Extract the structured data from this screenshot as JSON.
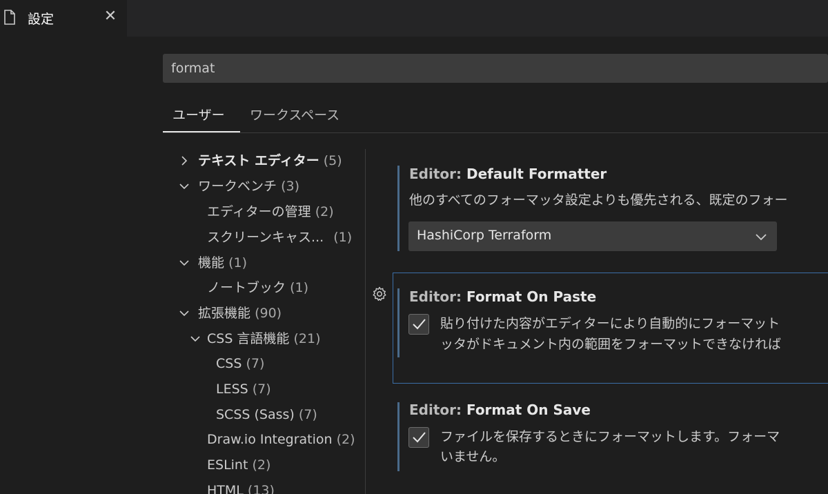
{
  "tab": {
    "title": "設定",
    "close": "✕"
  },
  "search": {
    "value": "format"
  },
  "scope_tabs": [
    "ユーザー",
    "ワークスペース"
  ],
  "toc": [
    {
      "chevron": "right",
      "label": "テキスト エディター",
      "count": "(5)",
      "bold": true
    },
    {
      "chevron": "down",
      "label": "ワークベンチ",
      "count": "(3)"
    },
    {
      "label": "エディターの管理",
      "count": "(2)"
    },
    {
      "label": "スクリーンキャス...",
      "count": "(1)"
    },
    {
      "chevron": "down",
      "label": "機能",
      "count": "(1)"
    },
    {
      "label": "ノートブック",
      "count": "(1)"
    },
    {
      "chevron": "down",
      "label": "拡張機能",
      "count": "(90)"
    },
    {
      "chevron": "down",
      "label": "CSS 言語機能",
      "count": "(21)"
    },
    {
      "label": "CSS",
      "count": "(7)"
    },
    {
      "label": "LESS",
      "count": "(7)"
    },
    {
      "label": "SCSS (Sass)",
      "count": "(7)"
    },
    {
      "label": "Draw.io Integration",
      "count": "(2)"
    },
    {
      "label": "ESLint",
      "count": "(2)"
    },
    {
      "label": "HTML",
      "count": "(13)"
    }
  ],
  "settings": {
    "default_formatter": {
      "category": "Editor: ",
      "name": "Default Formatter",
      "description": "他のすべてのフォーマッタ設定よりも優先される、既定のフォー",
      "value": "HashiCorp Terraform"
    },
    "format_on_paste": {
      "category": "Editor: ",
      "name": "Format On Paste",
      "desc_line1": "貼り付けた内容がエディターにより自動的にフォーマット",
      "desc_line2": "ッタがドキュメント内の範囲をフォーマットできなければ",
      "checked": true
    },
    "format_on_save": {
      "category": "Editor: ",
      "name": "Format On Save",
      "desc_line1": "ファイルを保存するときにフォーマットします。フォーマ",
      "desc_line2": "いません。",
      "checked": true
    }
  },
  "colors": {
    "accent_focus": "#3b6fa8",
    "modified_bar": "#4a6a8a"
  }
}
